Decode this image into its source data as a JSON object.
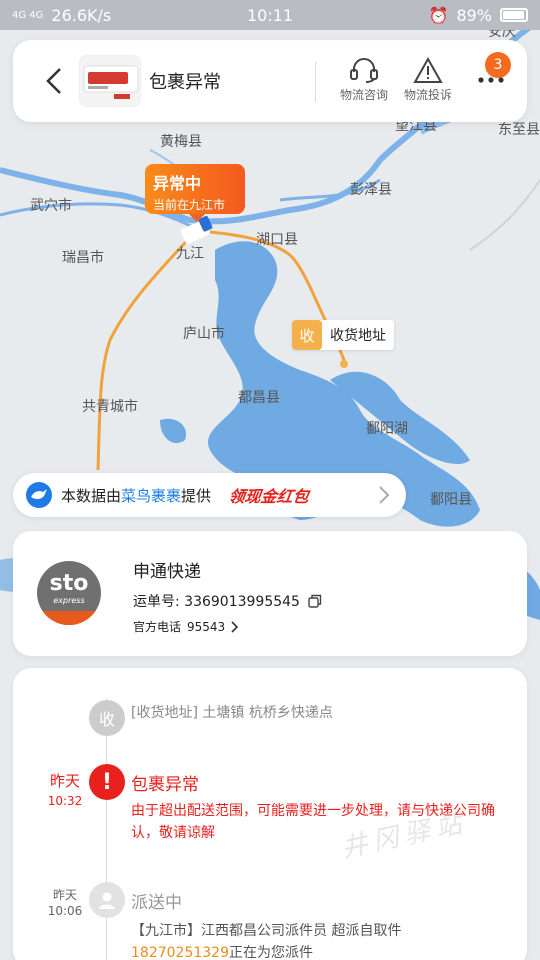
{
  "status_bar": {
    "signal": "4G 4G",
    "speed": "26.6K/s",
    "time": "10:11",
    "battery": "89%"
  },
  "header": {
    "title": "包裹异常",
    "actions": [
      {
        "label": "物流咨询",
        "icon": "headset-icon"
      },
      {
        "label": "物流投诉",
        "icon": "warning-icon"
      }
    ],
    "more_badge": "3"
  },
  "map": {
    "labels": [
      "黄梅县",
      "武穴市",
      "瑞昌市",
      "湖口县",
      "彭泽县",
      "庐山市",
      "共青城市",
      "都昌县",
      "鄱阳湖",
      "鄱阳县",
      "望江县",
      "东至县",
      "安庆",
      "九江"
    ],
    "current": {
      "title": "异常中",
      "subtitle": "当前在九江市"
    },
    "destination": {
      "badge": "收",
      "label": "收货地址"
    }
  },
  "cainiao": {
    "prefix": "本数据由",
    "brand": "菜鸟裹裹",
    "suffix": "提供",
    "promo": "领现金红包"
  },
  "carrier": {
    "name": "申通快递",
    "logo_text": "sto",
    "logo_sub": "express",
    "waybill_label": "运单号:",
    "waybill_no": "3369013995545",
    "phone_label": "官方电话",
    "phone": "95543"
  },
  "timeline": {
    "dest_node": "收",
    "dest_text": "[收货地址]  土塘镇   杭桥乡快递点",
    "events": [
      {
        "day": "昨天",
        "time": "10:32",
        "title": "包裹异常",
        "desc": "由于超出配送范围，可能需要进一步处理，请与快递公司确认，敬请谅解"
      },
      {
        "day": "昨天",
        "time": "10:06",
        "title": "派送中",
        "desc_pre": "【九江市】江西都昌公司派件员 超派自取件",
        "phone": "18270251329",
        "desc_post": "正在为您派件"
      }
    ]
  },
  "watermark": "井冈驿站",
  "colors": {
    "accent": "#f56a1e",
    "alert": "#e8211d",
    "water": "#5b9fe0",
    "route": "#f2a23c",
    "cainiao_blue": "#1e7be6"
  }
}
